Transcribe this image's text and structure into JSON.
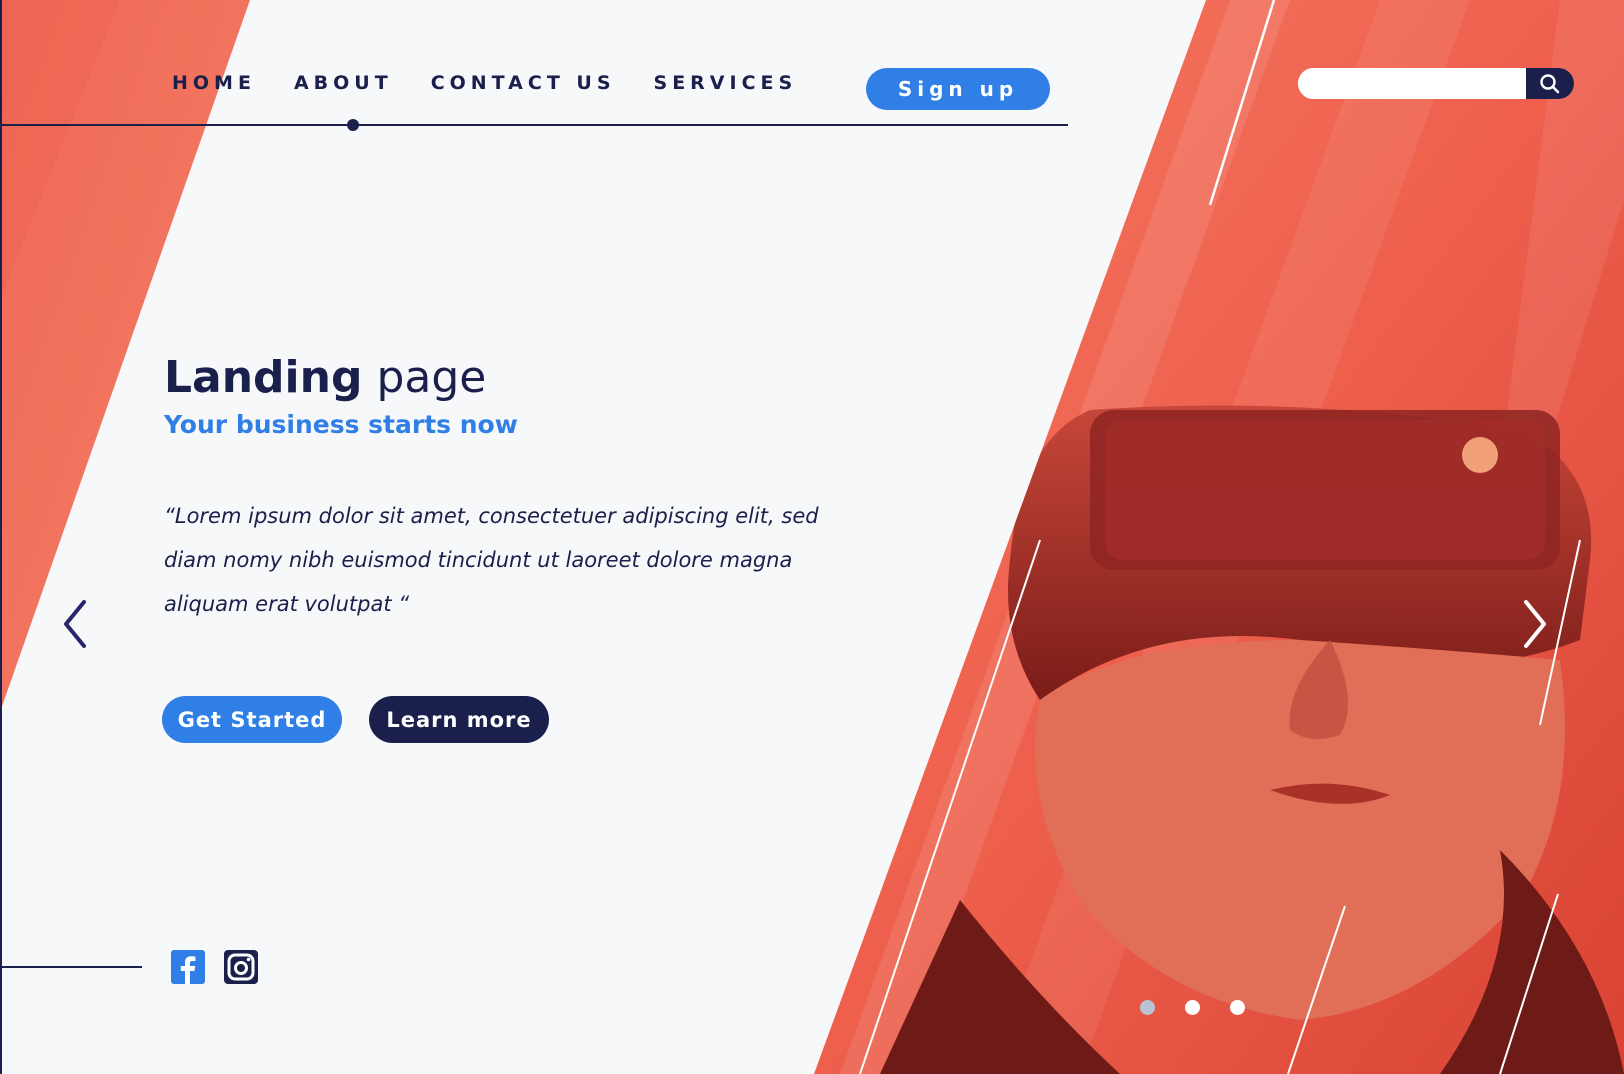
{
  "nav": {
    "items": [
      {
        "label": "HOME"
      },
      {
        "label": "ABOUT"
      },
      {
        "label": "CONTACT US"
      },
      {
        "label": "SERVICES"
      }
    ],
    "signup_label": "Sign up"
  },
  "search": {
    "placeholder": "",
    "icon": "search-icon"
  },
  "hero": {
    "title_bold": "Landing",
    "title_light": "page",
    "subtitle": "Your business starts now",
    "quote": "“Lorem ipsum dolor sit amet, consectetuer adipiscing elit, sed diam nomy nibh euismod tincidunt ut laoreet dolore magna aliquam erat volutpat “",
    "primary_button": "Get Started",
    "secondary_button": "Learn more"
  },
  "carousel": {
    "prev_icon": "chevron-left-icon",
    "next_icon": "chevron-right-icon",
    "dots": 3,
    "active_dot": 1
  },
  "social": {
    "icons": [
      "facebook-icon",
      "instagram-icon"
    ]
  },
  "colors": {
    "navy": "#1a1f4b",
    "blue": "#2f7fe6",
    "coral": "#f26b57",
    "background": "#f7f8fa"
  }
}
